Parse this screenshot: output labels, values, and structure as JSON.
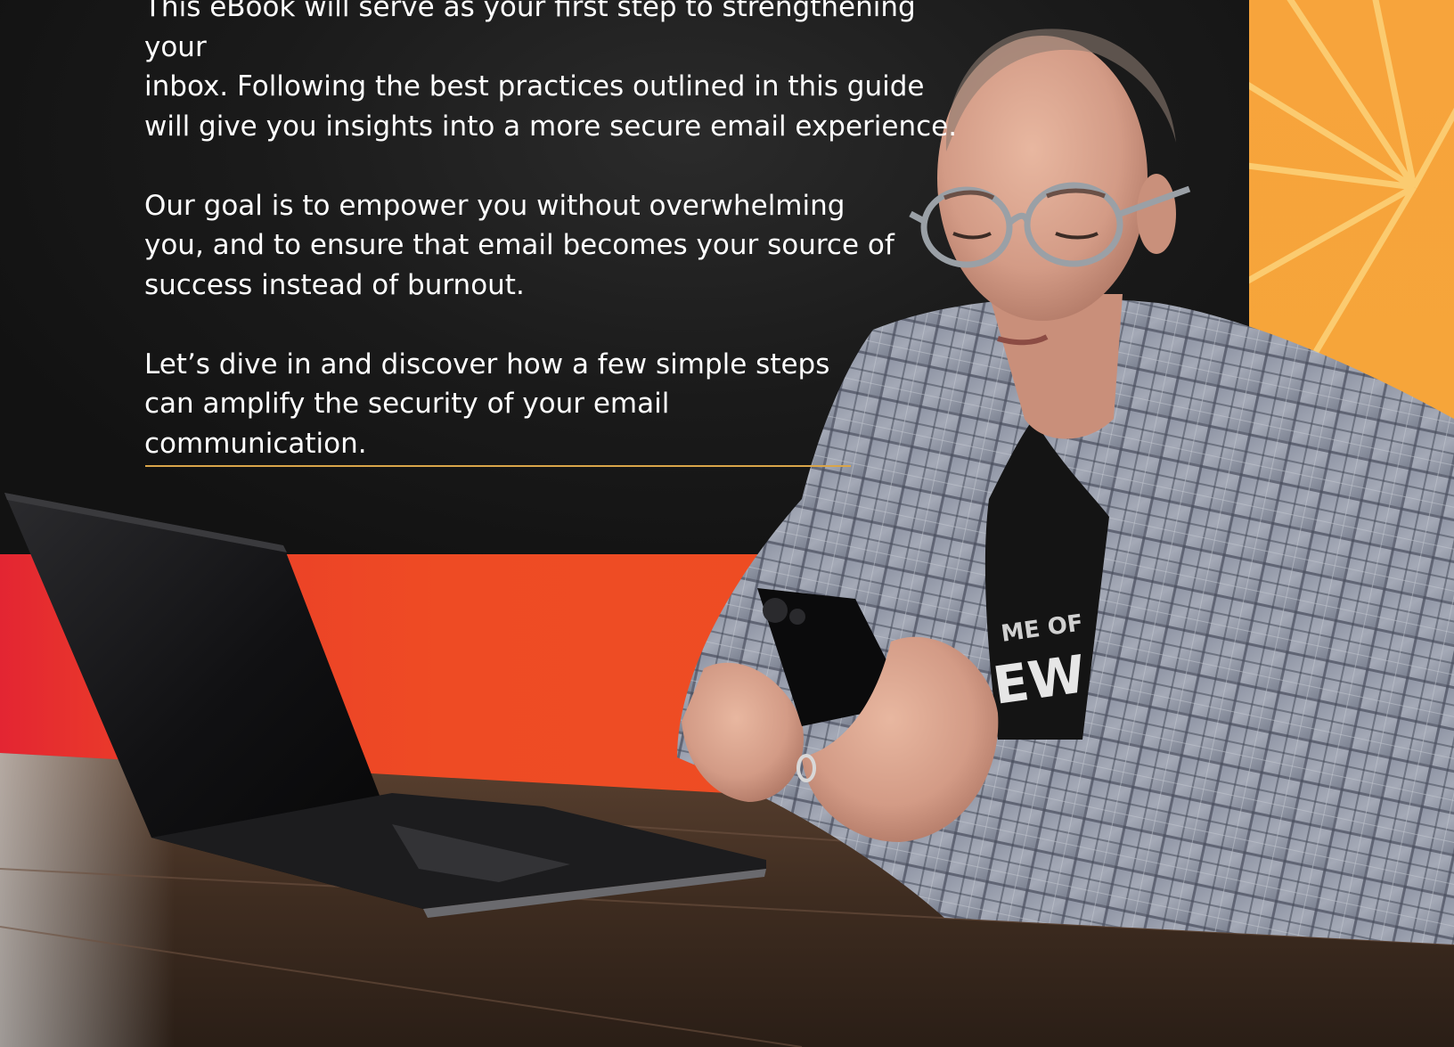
{
  "paragraphs": [
    "This eBook will serve as your first step to strengthening your\n inbox. Following the best practices outlined in this guide\nwill give you insights into a more secure email experience.",
    "Our goal is to empower you without overwhelming\nyou, and to ensure that email becomes your source of\nsuccess instead of burnout.",
    "Let’s dive in and discover how a few simple steps\ncan amplify the security of your email\ncommunication."
  ],
  "photo": {
    "shirt_text_top": "ME OF",
    "shirt_text_bottom": "EW"
  },
  "colors": {
    "dark": "#121212",
    "accent_gold": "#d9a54a",
    "orange": "#f7a43c",
    "red_orange": "#ee4b24",
    "text": "#ffffff"
  }
}
